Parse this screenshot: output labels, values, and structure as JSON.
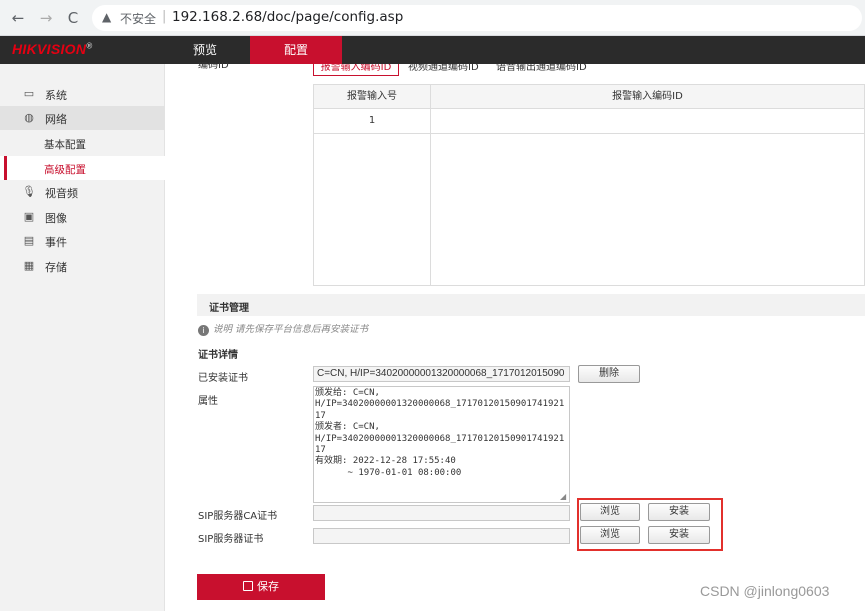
{
  "browser": {
    "back": "←",
    "forward": "→",
    "reload": "C",
    "warn": "▲",
    "insecure_label": "不安全",
    "separator": "|",
    "url": "192.168.2.68/doc/page/config.asp"
  },
  "header": {
    "logo": "HIKVISION",
    "logo_mark": "®",
    "tabs": {
      "preview": "预览",
      "config": "配置"
    }
  },
  "sidebar": {
    "items": [
      {
        "label": "系统",
        "icon": "monitor-icon"
      },
      {
        "label": "网络",
        "icon": "globe-icon"
      },
      {
        "label": "视音频",
        "icon": "microphone-icon"
      },
      {
        "label": "图像",
        "icon": "image-icon"
      },
      {
        "label": "事件",
        "icon": "calendar-icon"
      },
      {
        "label": "存储",
        "icon": "disk-icon"
      }
    ],
    "network_sub": [
      {
        "label": "基本配置"
      },
      {
        "label": "高级配置"
      }
    ]
  },
  "main": {
    "encode_id_label": "编码ID",
    "subtabs": [
      "报警输入编码ID",
      "视频通道编码ID",
      "语音输出通道编码ID"
    ],
    "table": {
      "headers": [
        "报警输入号",
        "报警输入编码ID"
      ],
      "rows": [
        {
          "num": "1",
          "code": ""
        }
      ]
    },
    "cert": {
      "section_title": "证书管理",
      "note": "说明 请先保存平台信息后再安装证书",
      "details_title": "证书详情",
      "installed_label": "已安装证书",
      "installed_value": "C=CN, H/IP=34020000001320000068_1717012015090",
      "delete_button": "删除",
      "attr_label": "属性",
      "attr_text": "颁发给: C=CN,\nH/IP=34020000001320000068_17170120150901741921\n17\n颁发者: C=CN,\nH/IP=34020000001320000068_17170120150901741921\n17\n有效期: 2022-12-28 17:55:40\n      ~ 1970-01-01 08:00:00",
      "sip_ca_label": "SIP服务器CA证书",
      "sip_cert_label": "SIP服务器证书",
      "browse_button": "浏览",
      "install_button": "安装"
    },
    "save_button": "保存"
  },
  "watermark": "CSDN @jinlong0603",
  "colors": {
    "accent": "#c8102e",
    "header_bg": "#2b2b2b",
    "highlight": "#e2302c"
  }
}
